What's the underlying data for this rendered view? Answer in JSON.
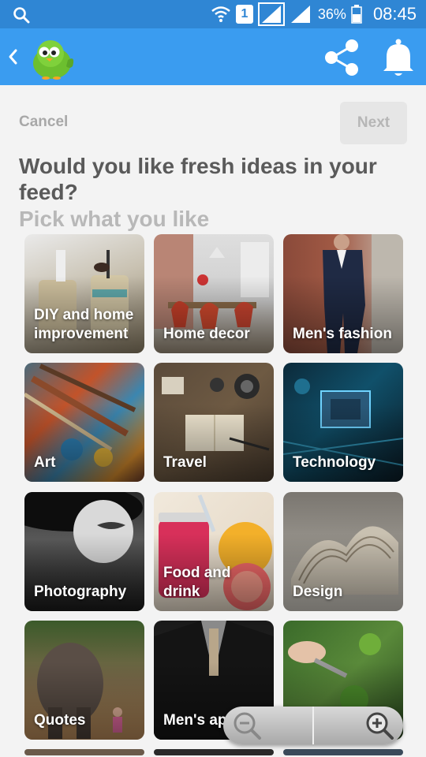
{
  "status_bar": {
    "sim_label": "1",
    "battery_percent": "36%",
    "time": "08:45",
    "icons": [
      "search-icon",
      "wifi-icon",
      "sim-icon",
      "signal-icon",
      "signal-icon",
      "battery-icon"
    ]
  },
  "app_bar": {
    "icons": [
      "back-icon",
      "bird-logo-icon",
      "share-icon",
      "bell-icon"
    ],
    "color": "#3a9cf0"
  },
  "onboarding": {
    "cancel_label": "Cancel",
    "next_label": "Next",
    "heading": "Would you like fresh ideas in your feed?",
    "subheading": "Pick what you like"
  },
  "topics": [
    {
      "label": "DIY and home improvement"
    },
    {
      "label": "Home decor"
    },
    {
      "label": "Men's fashion"
    },
    {
      "label": "Art"
    },
    {
      "label": "Travel"
    },
    {
      "label": "Technology"
    },
    {
      "label": "Photography"
    },
    {
      "label": "Food and drink"
    },
    {
      "label": "Design"
    },
    {
      "label": "Quotes"
    },
    {
      "label": "Men's apparel"
    },
    {
      "label": ""
    }
  ],
  "zoom_control": {
    "icons": [
      "zoom-out-icon",
      "zoom-in-icon"
    ]
  }
}
